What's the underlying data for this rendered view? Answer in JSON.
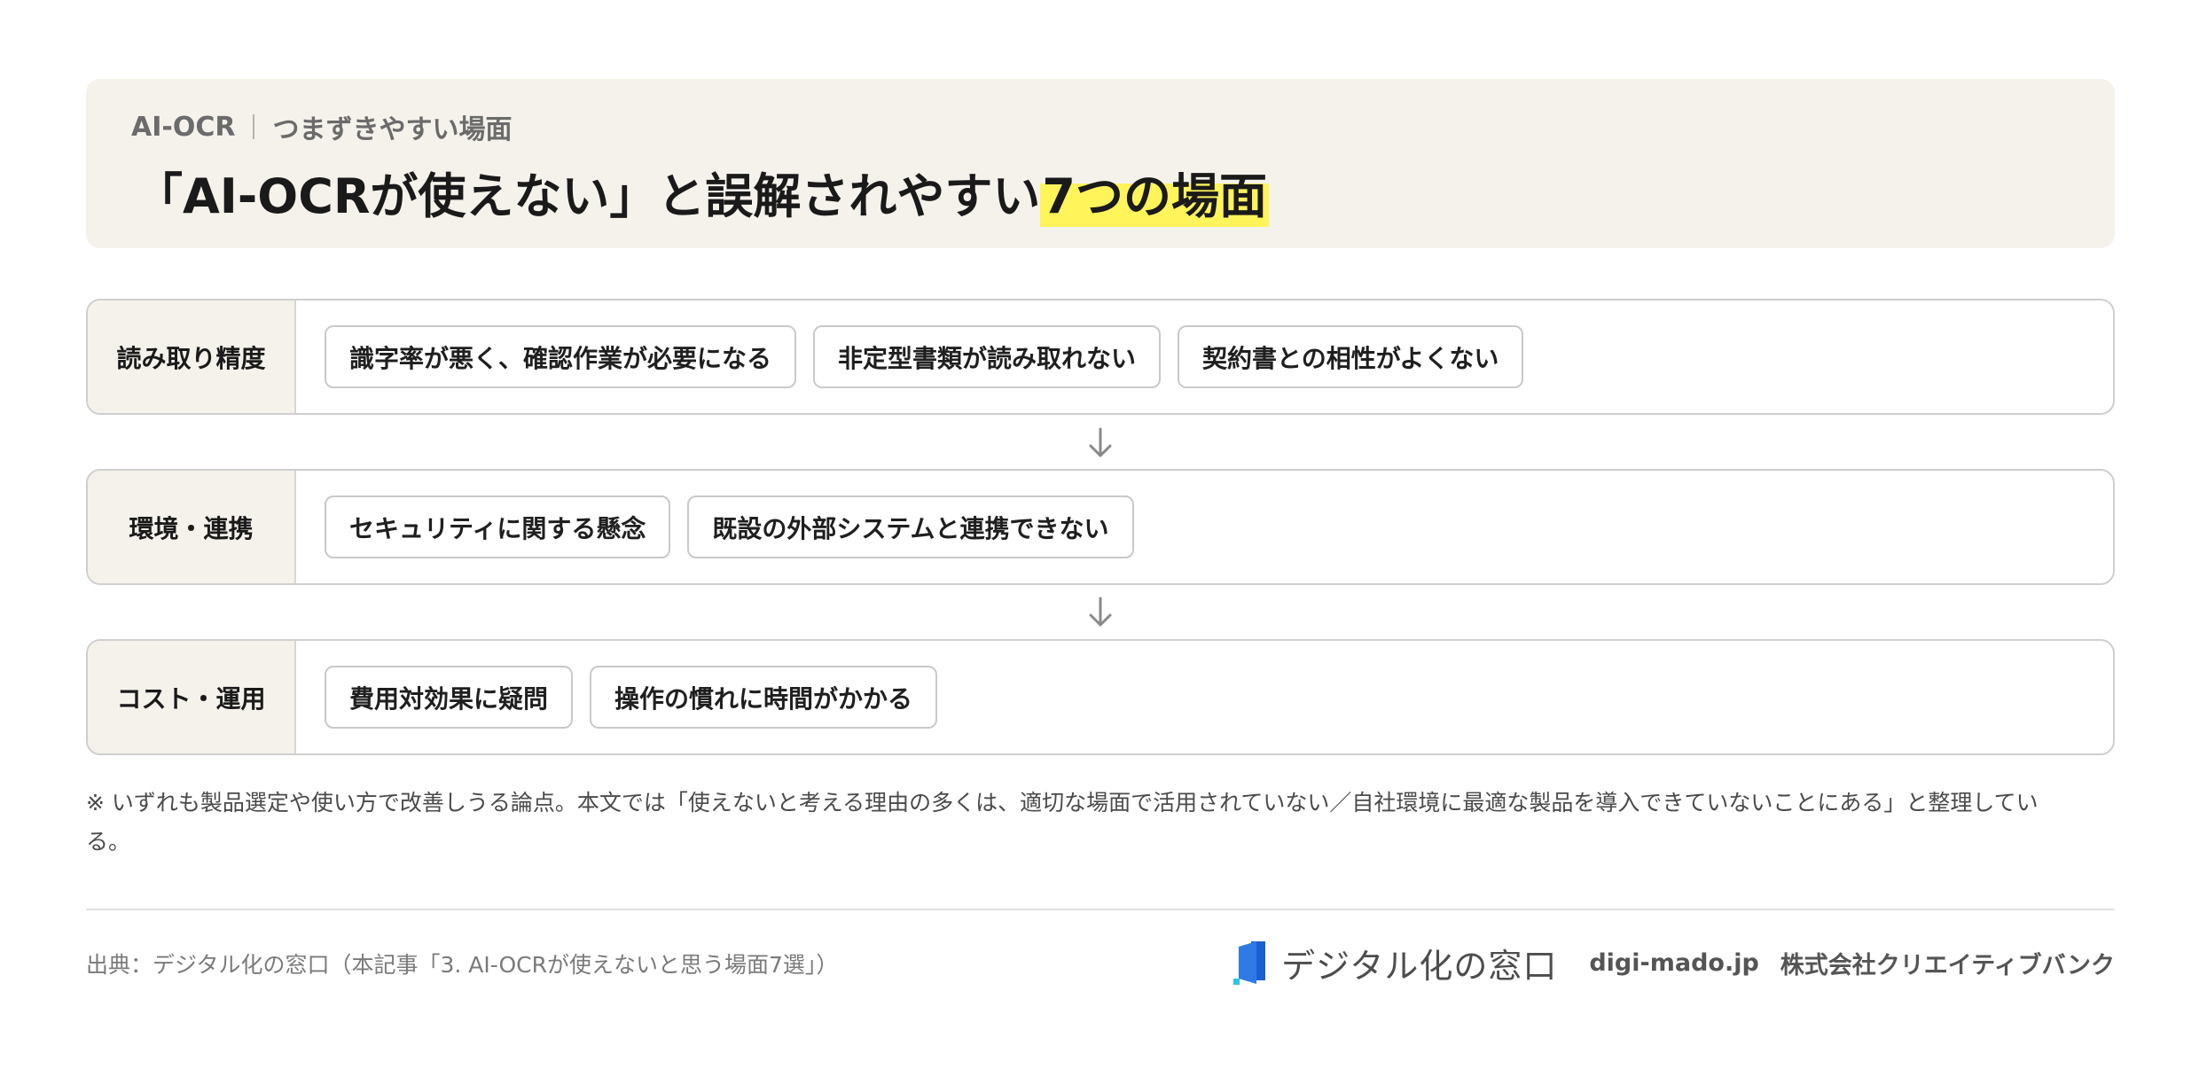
{
  "header": {
    "kicker_left": "AI-OCR",
    "kicker_right": "つまずきやすい場面",
    "title_main": "「AI-OCRが使えない」と誤解されやすい",
    "title_highlight": "7つの場面",
    "highlight_color": "#fff45a"
  },
  "rows": [
    {
      "label": "読み取り精度",
      "items": [
        "識字率が悪く、確認作業が必要になる",
        "非定型書類が読み取れない",
        "契約書との相性がよくない"
      ]
    },
    {
      "label": "環境・連携",
      "items": [
        "セキュリティに関する懸念",
        "既設の外部システムと連携できない"
      ]
    },
    {
      "label": "コスト・運用",
      "items": [
        "費用対効果に疑問",
        "操作の慣れに時間がかかる"
      ]
    }
  ],
  "note": "※ いずれも製品選定や使い方で改善しうる論点。本文では「使えないと考える理由の多くは、適切な場面で活用されていない／自社環境に最適な製品を導入できていないことにある」と整理している。",
  "footer": {
    "source": "出典：デジタル化の窓口（本記事「3. AI-OCRが使えないと思う場面7選」）",
    "brand_name": "デジタル化の窓口",
    "domain": "digi-mado.jp",
    "company": "株式会社クリエイティブバンク",
    "logo_icon": "window-logo-icon",
    "arrow_icon": "arrow-down-icon",
    "brand_color": "#1a5fd0",
    "accent_color": "#2bc4e8"
  }
}
